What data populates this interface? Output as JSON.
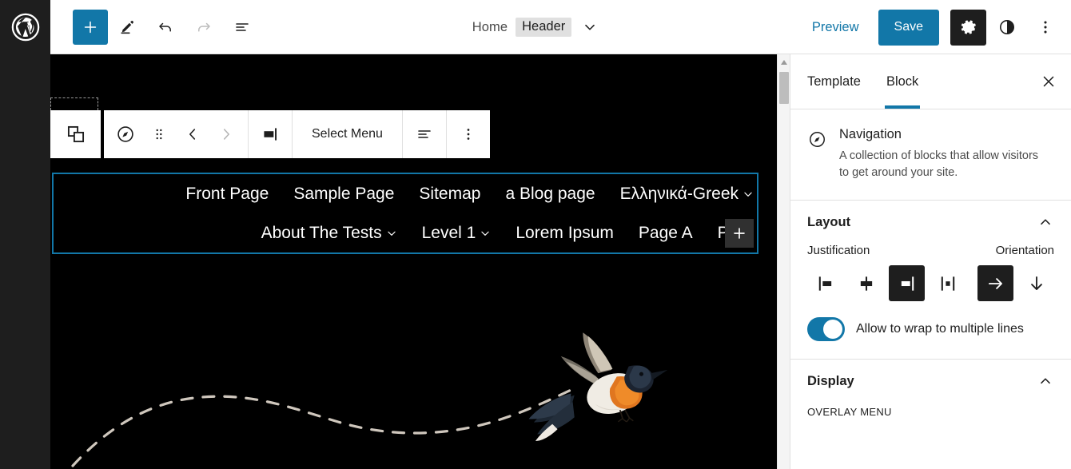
{
  "header": {
    "logo_icon": "wordpress-logo-icon",
    "tools": [
      {
        "name": "add-block-button",
        "icon": "plus-icon",
        "label": "+",
        "state": "primary"
      },
      {
        "name": "edit-mode-button",
        "icon": "pencil-icon",
        "label": "",
        "state": "normal"
      },
      {
        "name": "undo-button",
        "icon": "undo-icon",
        "label": "",
        "state": "normal"
      },
      {
        "name": "redo-button",
        "icon": "redo-icon",
        "label": "",
        "state": "disabled"
      },
      {
        "name": "list-view-button",
        "icon": "list-view-icon",
        "label": "",
        "state": "normal"
      }
    ],
    "breadcrumb": {
      "parent": "Home",
      "current": "Header",
      "chevron_icon": "chevron-down-icon"
    },
    "preview_label": "Preview",
    "save_label": "Save",
    "settings_icon": "gear-icon",
    "styles_icon": "contrast-half-circle-icon",
    "more_icon": "more-vertical-dots-icon"
  },
  "canvas": {
    "parent_selector_icon": "select-parent-blocks-icon",
    "block_toolbar": {
      "block_type_icon": "navigation-compass-icon",
      "drag_icon": "drag-handle-dots-icon",
      "move_up_icon": "chevron-left-icon",
      "move_down_icon": "chevron-right-icon",
      "align_icon": "align-right-icon",
      "select_menu_label": "Select Menu",
      "justify_icon": "justify-items-icon",
      "options_icon": "more-vertical-dots-icon"
    },
    "navigation": {
      "row1": [
        {
          "label": "Front Page",
          "has_submenu": false
        },
        {
          "label": "Sample Page",
          "has_submenu": false
        },
        {
          "label": "Sitemap",
          "has_submenu": false
        },
        {
          "label": "a Blog page",
          "has_submenu": false
        },
        {
          "label": "Ελληνικά-Greek",
          "has_submenu": true
        }
      ],
      "row2": [
        {
          "label": "About The Tests",
          "has_submenu": true
        },
        {
          "label": "Level 1",
          "has_submenu": true
        },
        {
          "label": "Lorem Ipsum",
          "has_submenu": false
        },
        {
          "label": "Page A",
          "has_submenu": false
        },
        {
          "label": "Pag",
          "has_submenu": false
        }
      ],
      "appender_label": "+",
      "selected_outline_color": "#1277a8"
    },
    "illustration": "flying-bird-with-dashed-trail"
  },
  "scrollbar": {
    "up_arrow_icon": "scroll-up-arrow-icon",
    "thumb_name": "canvas-scroll-thumb"
  },
  "sidebar": {
    "tabs": [
      {
        "label": "Template",
        "active": false
      },
      {
        "label": "Block",
        "active": true
      }
    ],
    "close_icon": "close-x-icon",
    "block_card": {
      "icon": "navigation-compass-icon",
      "title": "Navigation",
      "description": "A collection of blocks that allow visitors to get around your site."
    },
    "layout_panel": {
      "title": "Layout",
      "collapse_icon": "chevron-up-icon",
      "justification_label": "Justification",
      "orientation_label": "Orientation",
      "justification_options": [
        {
          "name": "justify-left-button",
          "icon": "justify-left-icon",
          "selected": false
        },
        {
          "name": "justify-center-button",
          "icon": "justify-center-icon",
          "selected": false
        },
        {
          "name": "justify-right-button",
          "icon": "justify-right-icon",
          "selected": true
        },
        {
          "name": "justify-space-between-button",
          "icon": "justify-space-between-icon",
          "selected": false
        }
      ],
      "orientation_options": [
        {
          "name": "orientation-horizontal-button",
          "icon": "arrow-right-icon",
          "selected": true
        },
        {
          "name": "orientation-vertical-button",
          "icon": "arrow-down-icon",
          "selected": false
        }
      ],
      "wrap_toggle": {
        "label": "Allow to wrap to multiple lines",
        "enabled": true
      }
    },
    "display_panel": {
      "title": "Display",
      "collapse_icon": "chevron-up-icon",
      "overlay_menu_label": "OVERLAY MENU"
    }
  },
  "colors": {
    "accent": "#1277a8",
    "dark": "#1e1e1e",
    "canvas_bg": "#000000",
    "border": "#e0e0e0"
  }
}
